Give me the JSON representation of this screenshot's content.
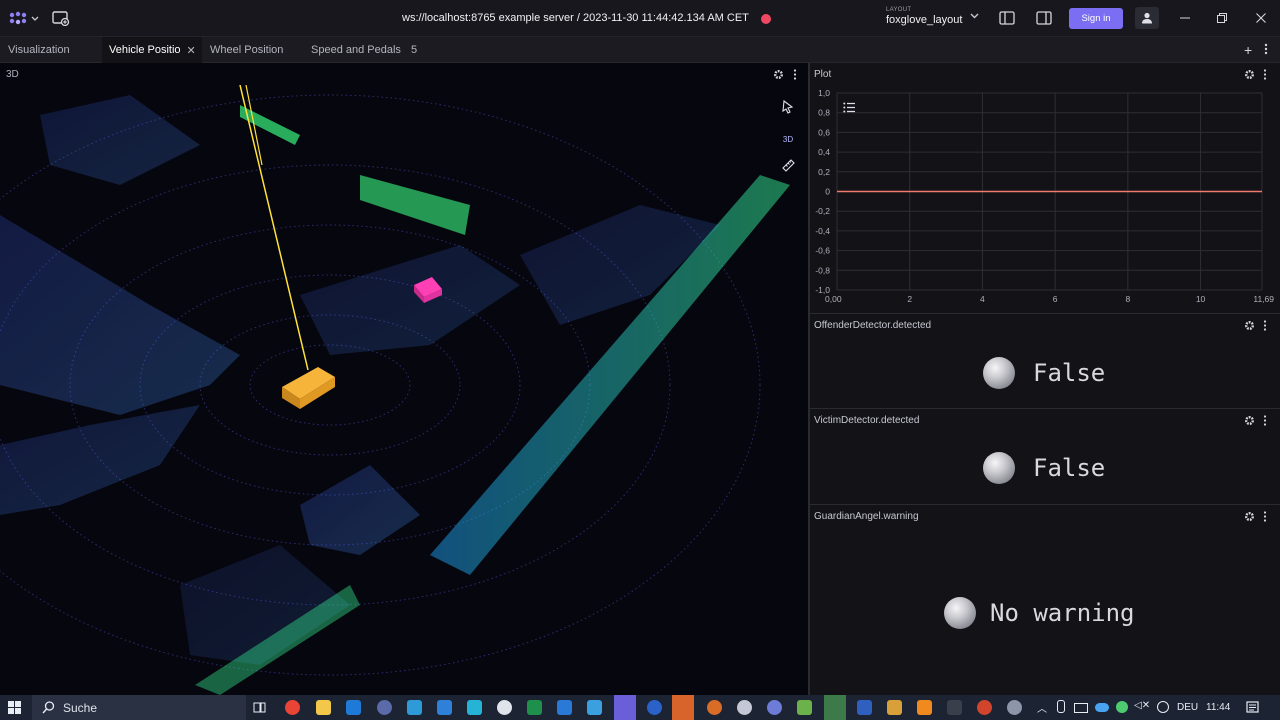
{
  "titlebar": {
    "connection": "ws://localhost:8765 example server / 2023-11-30 11:44:42.134 AM CET",
    "layout_caption": "LAYOUT",
    "layout_name": "foxglove_layout",
    "signin_label": "Sign in",
    "status_dot_color": "#f04863",
    "accent_color": "#7b6ef3"
  },
  "tabs": [
    {
      "label": "Visualization"
    },
    {
      "label": "Vehicle Positio",
      "active": true
    },
    {
      "label": "Wheel Position"
    },
    {
      "label": "Speed and Pedals"
    },
    {
      "label": "5"
    }
  ],
  "panel_3d": {
    "title": "3D",
    "mode_label": "3D"
  },
  "plot": {
    "title": "Plot",
    "chart_data": {
      "type": "line",
      "title": "",
      "xlabel": "",
      "ylabel": "",
      "xlim": [
        0,
        11.69
      ],
      "ylim": [
        -1.0,
        1.0
      ],
      "x_ticks": [
        "0,00",
        "2",
        "4",
        "6",
        "8",
        "10",
        "11,69"
      ],
      "y_ticks": [
        "1,0",
        "0,8",
        "0,6",
        "0,4",
        "0,2",
        "0",
        "-0,2",
        "-0,4",
        "-0,6",
        "-0,8",
        "-1,0"
      ],
      "series": [
        {
          "x": [
            0,
            11.69
          ],
          "y": [
            0,
            0
          ],
          "color": "#f07a6e"
        }
      ],
      "grid": true
    }
  },
  "indicators": [
    {
      "title": "OffenderDetector.detected",
      "value": "False"
    },
    {
      "title": "VictimDetector.detected",
      "value": "False"
    },
    {
      "title": "GuardianAngel.warning",
      "value": "No warning"
    }
  ],
  "taskbar": {
    "search_label": "Suche",
    "language": "DEU",
    "time": "11:44"
  }
}
